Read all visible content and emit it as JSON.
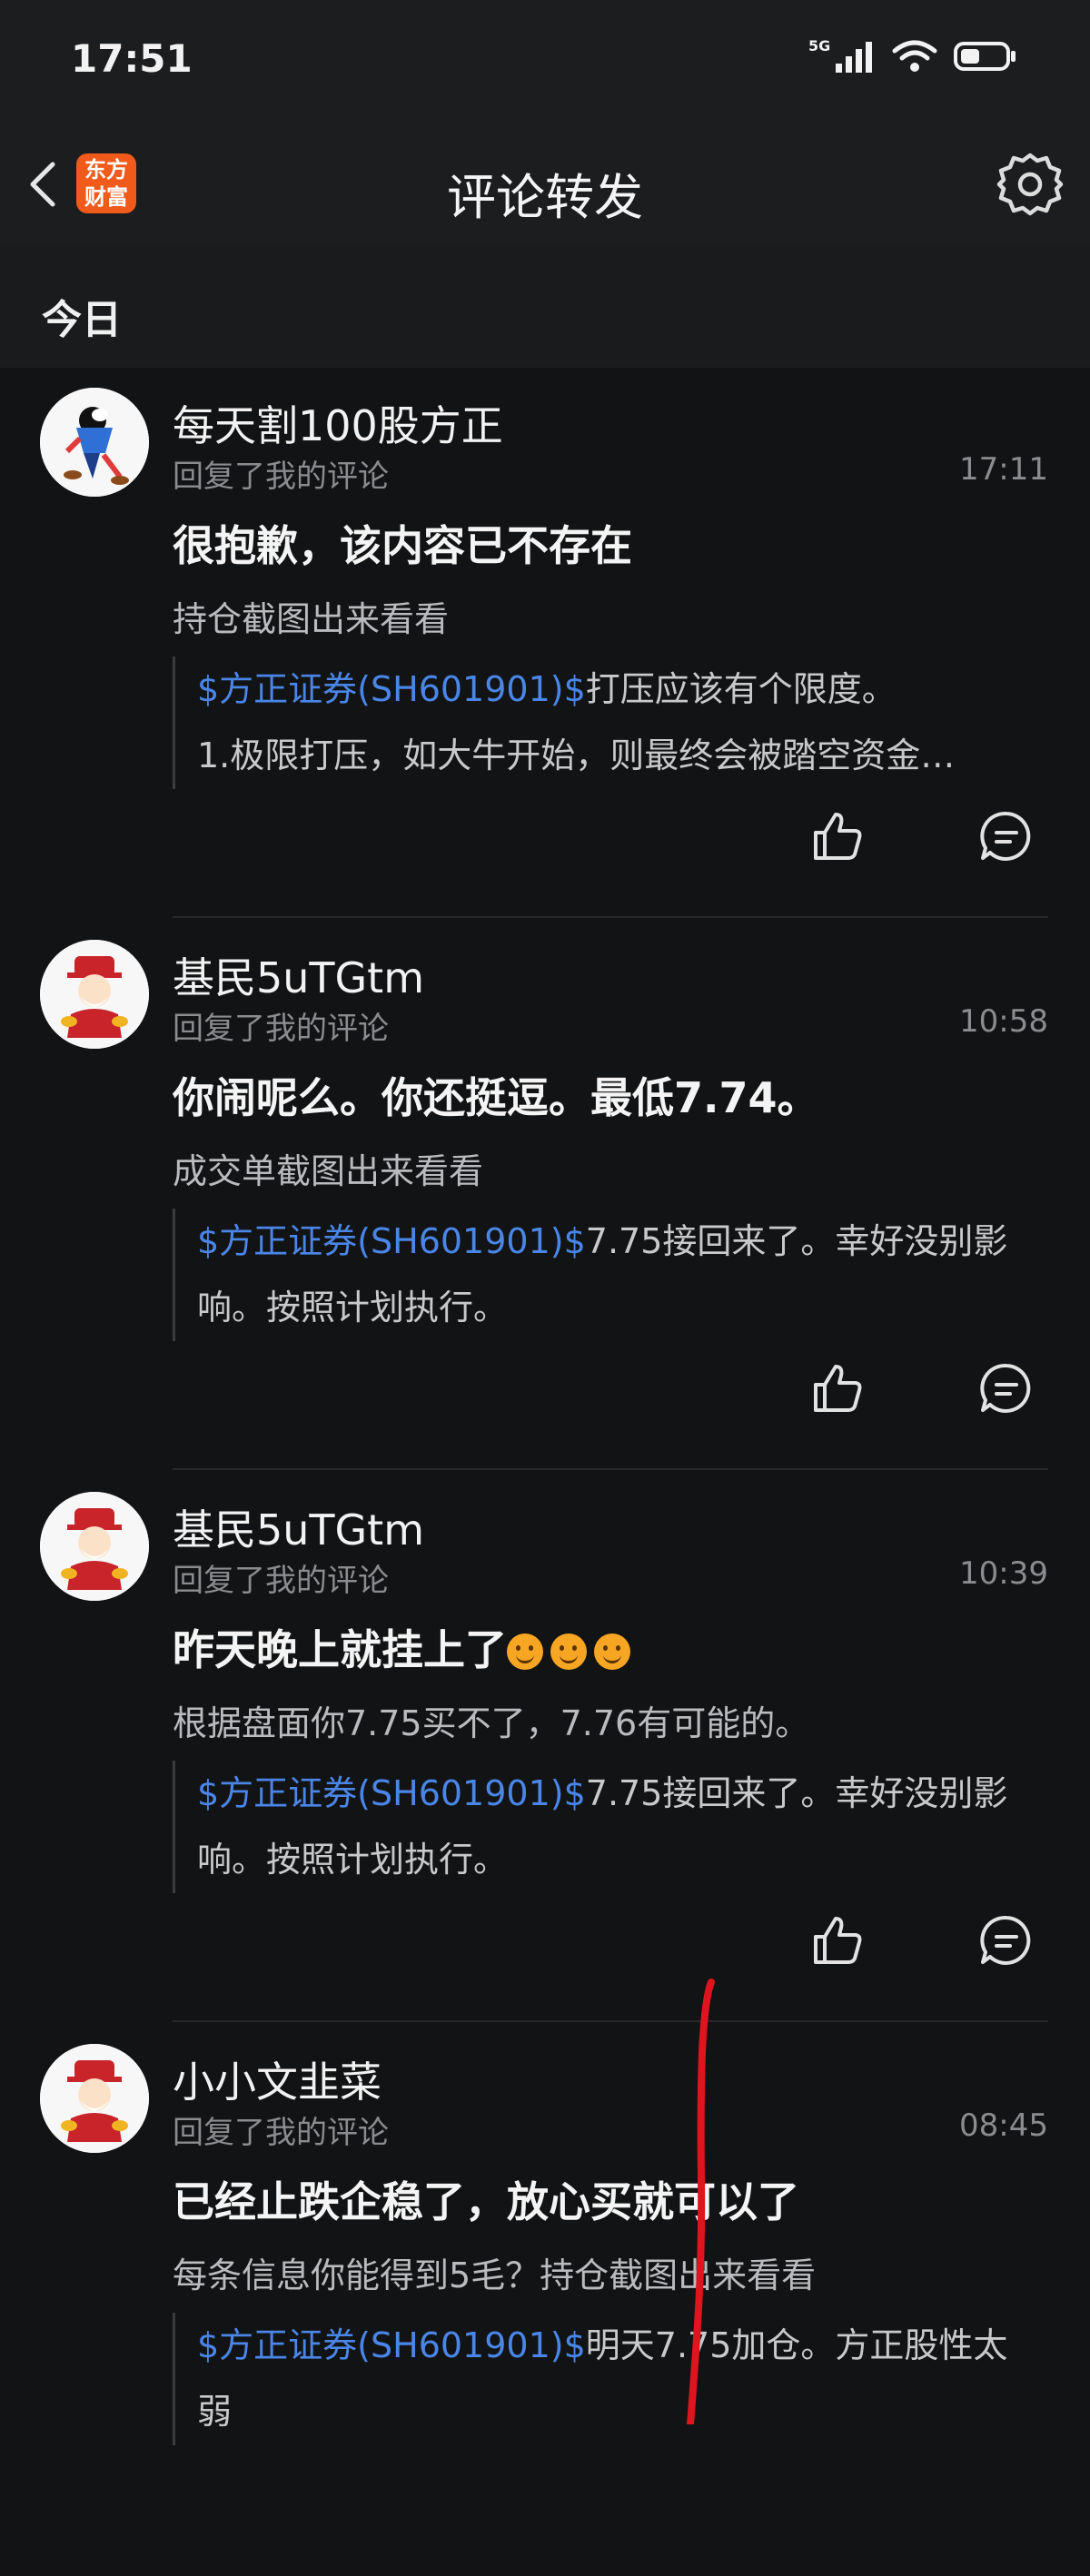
{
  "status": {
    "time": "17:51",
    "network": "5G"
  },
  "nav": {
    "logo_text_1": "东方",
    "logo_text_2": "财富",
    "title": "评论转发"
  },
  "section": {
    "label": "今日"
  },
  "colors": {
    "background": "#121314",
    "link": "#4a86e8",
    "logo": "#f05a1a",
    "annotation": "#e0141e"
  },
  "comments": [
    {
      "user": "每天割100股方正",
      "action": "回复了我的评论",
      "time": "17:11",
      "reply": " 很抱歉，该内容已不存在",
      "original": "持仓截图出来看看",
      "quote_stock": "$方正证券(SH601901)$",
      "quote_line1": "打压应该有个限度。",
      "quote_line2": "1.极限打压，如大牛开始，则最终会被踏空资金…"
    },
    {
      "user": "基民5uTGtm",
      "action": "回复了我的评论",
      "time": "10:58",
      "reply": "你闹呢么。你还挺逗。最低7.74。",
      "original": "成交单截图出来看看",
      "quote_stock": "$方正证券(SH601901)$",
      "quote_line1": "7.75接回来了。幸好没别影",
      "quote_line2": "响。按照计划执行。"
    },
    {
      "user": "基民5uTGtm",
      "action": "回复了我的评论",
      "time": "10:39",
      "reply": "昨天晚上就挂上了",
      "original": "根据盘面你7.75买不了，7.76有可能的。",
      "quote_stock": "$方正证券(SH601901)$",
      "quote_line1": "7.75接回来了。幸好没别影",
      "quote_line2": "响。按照计划执行。"
    },
    {
      "user": "小小文韭菜",
      "action": "回复了我的评论",
      "time": "08:45",
      "reply": "已经止跌企稳了，放心买就可以了",
      "original": "每条信息你能得到5毛？持仓截图出来看看",
      "quote_stock": "$方正证券(SH601901)$",
      "quote_line1": "明天7.75加仓。方正股性太",
      "quote_line2": "弱"
    }
  ]
}
